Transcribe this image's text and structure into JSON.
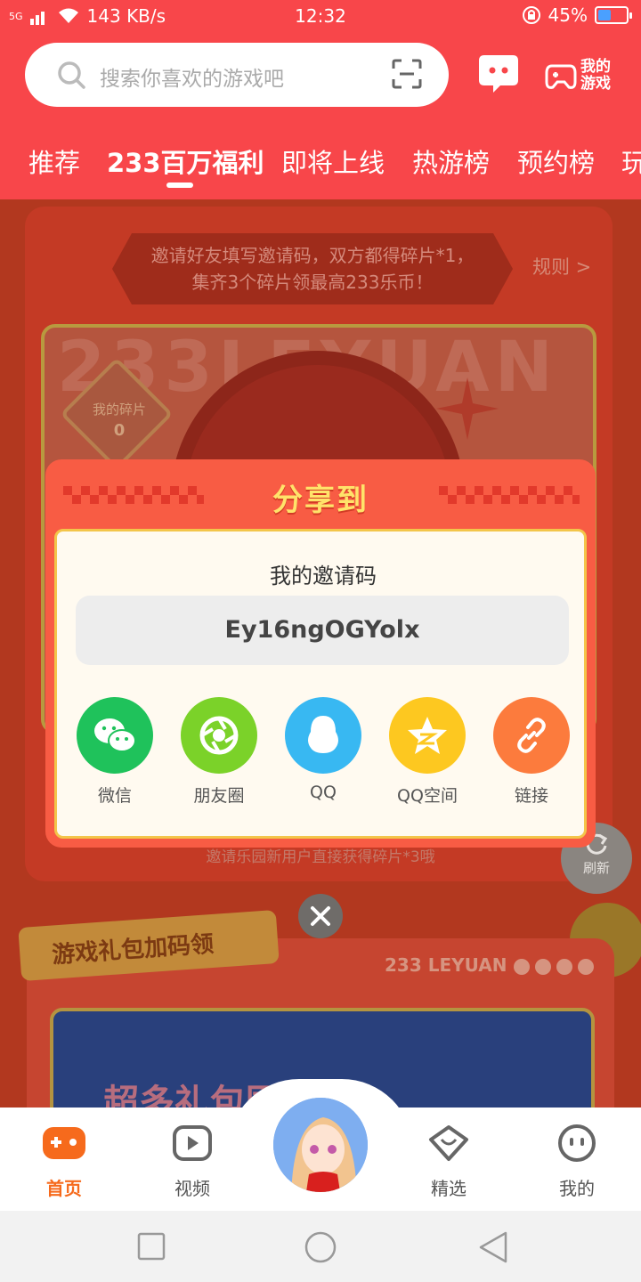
{
  "status_bar": {
    "network": "5G",
    "speed": "143 KB/s",
    "time": "12:32",
    "battery": "45%",
    "battery_level": 0.45
  },
  "header": {
    "search_placeholder": "搜索你喜欢的游戏吧",
    "my_games_line1": "我的",
    "my_games_line2": "游戏"
  },
  "tabs": [
    {
      "label": "推荐"
    },
    {
      "label": "233百万福利"
    },
    {
      "label": "即将上线"
    },
    {
      "label": "热游榜"
    },
    {
      "label": "预约榜"
    },
    {
      "label": "玩"
    }
  ],
  "background": {
    "invite_line1": "邀请好友填写邀请码，双方都得碎片*1，",
    "invite_line2": "集齐3个碎片领最高233乐币！",
    "rule_link": "规则 >",
    "big_text": "233LEYUAN",
    "shard_label": "我的碎片",
    "shard_count": "0",
    "note": "邀请乐园新用户直接获得碎片*3哦",
    "refresh": "刷新",
    "gift_tag": "游戏礼包加码领",
    "leyuan": "233 LEYUAN",
    "gift_banner": "超多礼包围观"
  },
  "dialog": {
    "title": "分享到",
    "invite_label": "我的邀请码",
    "invite_code": "Ey16ngOGYolx",
    "share_items": [
      {
        "label": "微信",
        "color": "#1fc25b",
        "icon": "wechat-icon"
      },
      {
        "label": "朋友圈",
        "color": "#7bd229",
        "icon": "moments-icon"
      },
      {
        "label": "QQ",
        "color": "#38b8f2",
        "icon": "qq-icon"
      },
      {
        "label": "QQ空间",
        "color": "#fdc820",
        "icon": "qzone-icon"
      },
      {
        "label": "链接",
        "color": "#fc7b3d",
        "icon": "link-icon"
      }
    ]
  },
  "bottom_nav": [
    {
      "label": "首页",
      "active": true
    },
    {
      "label": "视频",
      "active": false
    },
    {
      "label": "精选",
      "active": false
    },
    {
      "label": "我的",
      "active": false
    }
  ],
  "colors": {
    "brand_red": "#f8464a",
    "accent_orange": "#f66a1c"
  }
}
